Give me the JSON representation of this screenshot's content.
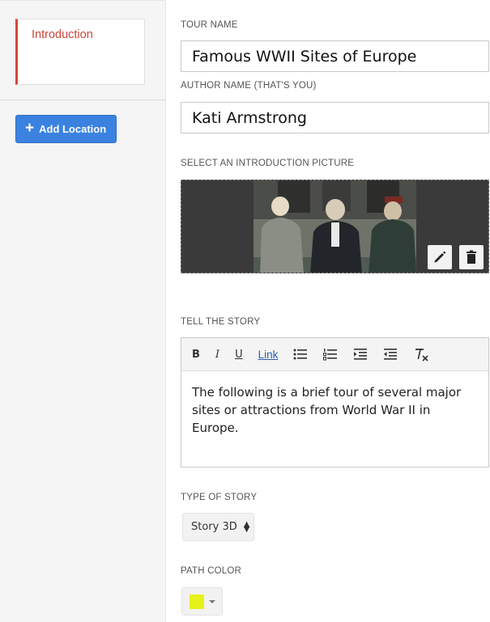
{
  "sidebar": {
    "intro_label": "Introduction",
    "add_location_label": "Add Location",
    "accent_color": "#d24a3b",
    "button_color": "#3b82e0"
  },
  "form": {
    "tour_name_label": "TOUR NAME",
    "tour_name_value": "Famous WWII Sites of Europe",
    "author_label": "AUTHOR NAME (THAT'S YOU)",
    "author_value": "Kati Armstrong",
    "picture_label": "SELECT AN INTRODUCTION PICTURE",
    "picture_alt": "Yalta conference photo",
    "story_label": "TELL THE STORY",
    "toolbar": {
      "bold": "B",
      "italic": "I",
      "underline": "U",
      "link": "Link",
      "icons": [
        "bulleted-list-icon",
        "numbered-list-icon",
        "indent-icon",
        "outdent-icon",
        "clear-format-icon"
      ]
    },
    "story_text": "The following is a brief tour of several major sites or attractions from World War II in Europe.",
    "story_type_label": "TYPE OF STORY",
    "story_type_value": "Story 3D",
    "path_color_label": "PATH COLOR",
    "path_color_value": "#e6f21a"
  }
}
